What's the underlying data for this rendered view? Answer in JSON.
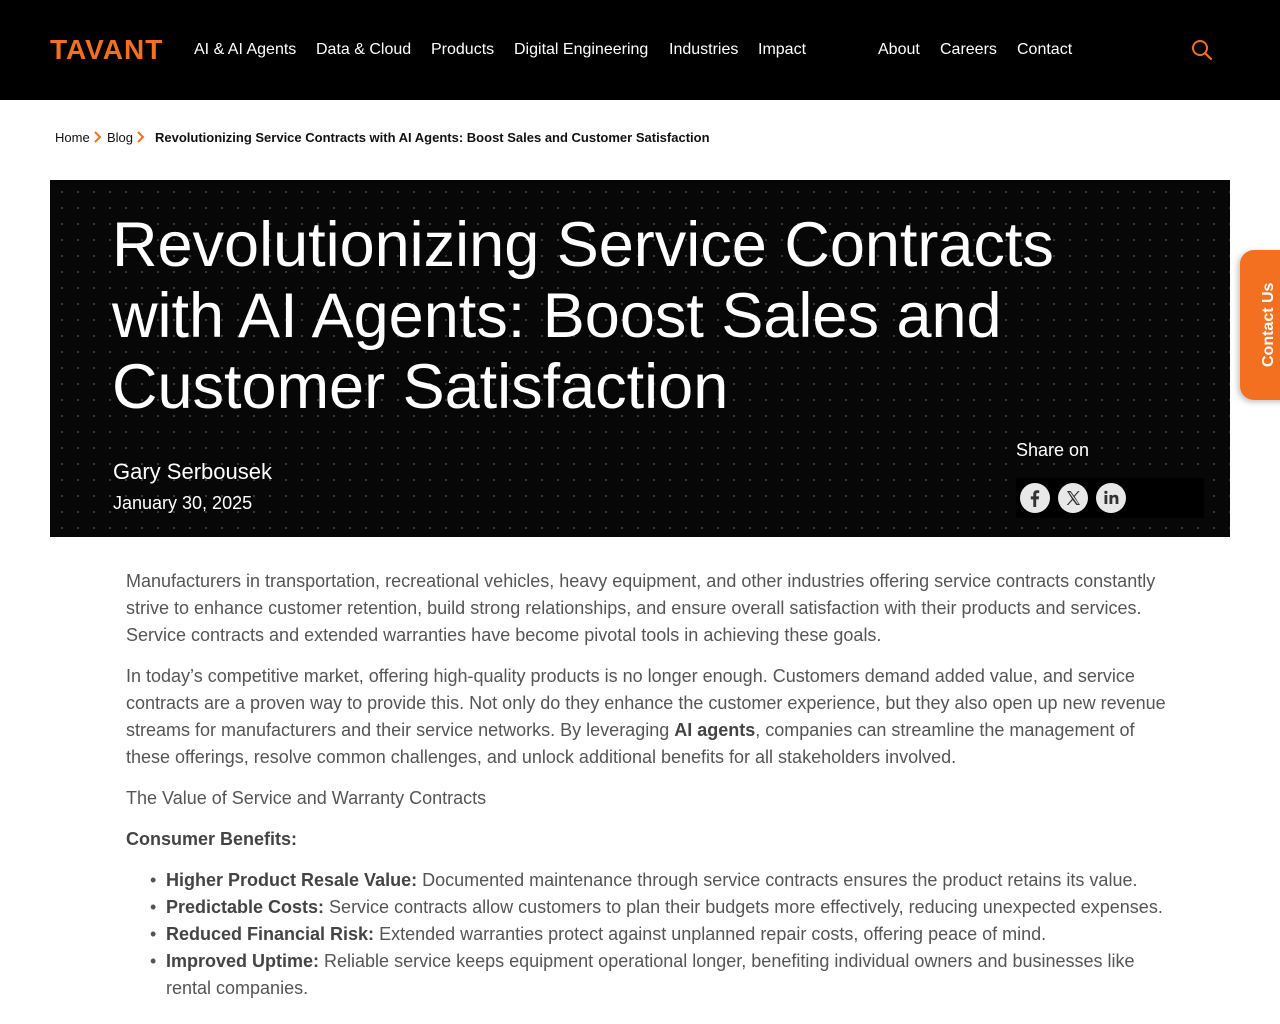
{
  "header": {
    "logo": "TAVANT",
    "nav_primary": [
      "AI & AI Agents",
      "Data & Cloud",
      "Products",
      "Digital Engineering",
      "Industries",
      "Impact"
    ],
    "nav_secondary": [
      "About",
      "Careers",
      "Contact"
    ],
    "search_icon": "search-icon",
    "colors": {
      "background": "#000000",
      "accent": "#f37021"
    }
  },
  "breadcrumb": {
    "home": "Home",
    "blog": "Blog",
    "current": "Revolutionizing Service Contracts with AI Agents: Boost Sales and Customer Satisfaction"
  },
  "hero": {
    "title": "Revolutionizing Service Contracts with AI Agents: Boost Sales and Customer Satisfaction",
    "author": "Gary Serbousek",
    "date": "January 30, 2025",
    "share_label": "Share on",
    "share_icons": [
      "facebook-icon",
      "x-icon",
      "linkedin-icon"
    ]
  },
  "contact_tab": {
    "label": "Contact Us"
  },
  "article": {
    "p1": "Manufacturers in transportation, recreational vehicles, heavy equipment, and other industries offering service contracts constantly strive to enhance customer retention, build strong relationships, and ensure overall satisfaction with their products and services. Service contracts and extended warranties have become pivotal tools in achieving these goals.",
    "p2_before": "In today’s competitive market, offering high-quality products is no longer enough. Customers demand added value, and service contracts are a proven way to provide this. Not only do they enhance the customer experience, but they also open up new revenue streams for manufacturers and their service networks. By leveraging ",
    "p2_link": "AI agents",
    "p2_after": ", companies can streamline the management of these offerings, resolve common challenges, and unlock additional benefits for all stakeholders involved.",
    "p3": "The Value of Service and Warranty Contracts",
    "benefits_heading": "Consumer Benefits:",
    "bullet_char": "•",
    "benefits": [
      {
        "title": "Higher Product Resale Value:",
        "text": " Documented maintenance through service contracts ensures the product retains its value."
      },
      {
        "title": "Predictable Costs:",
        "text": " Service contracts allow customers to plan their budgets more effectively, reducing unexpected expenses."
      },
      {
        "title": "Reduced Financial Risk:",
        "text": " Extended warranties protect against unplanned repair costs, offering peace of mind."
      },
      {
        "title": "Improved Uptime:",
        "text": " Reliable service keeps equipment operational longer, benefiting individual owners and businesses like rental companies."
      }
    ]
  }
}
